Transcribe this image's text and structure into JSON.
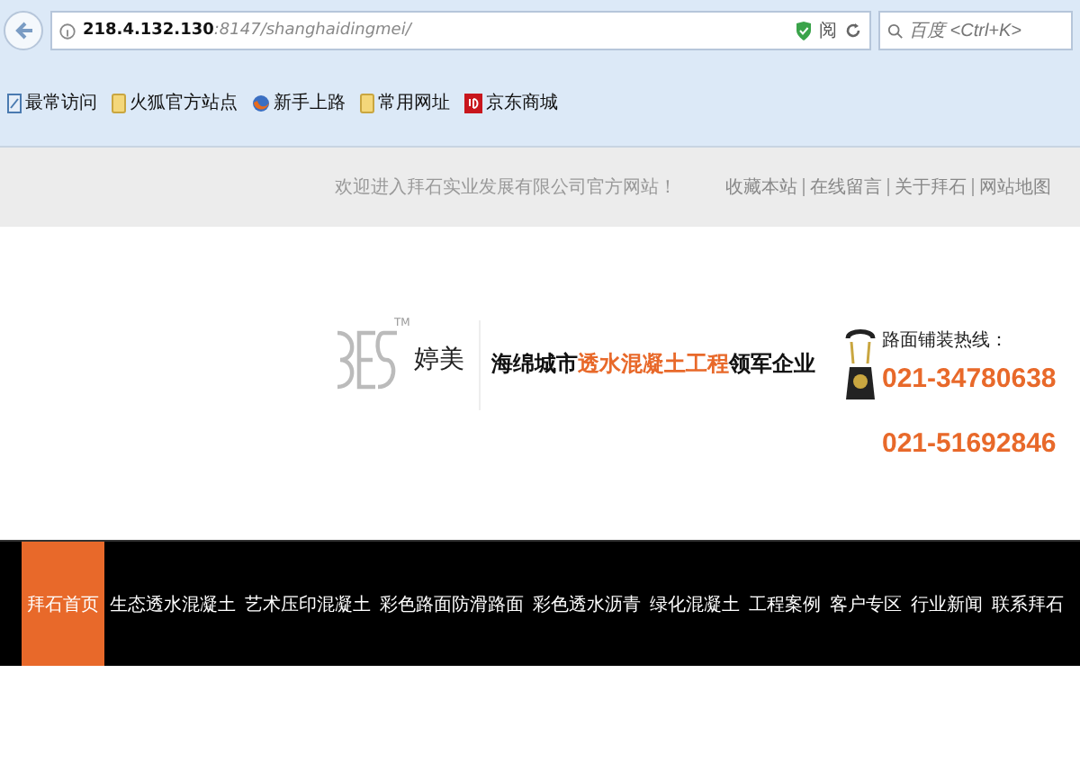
{
  "browser": {
    "url_host": "218.4.132.130",
    "url_path": ":8147/shanghaidingmei/",
    "reader_label": "阅",
    "search_placeholder": "百度 <Ctrl+K>",
    "bookmarks": [
      {
        "label": "最常访问",
        "kind": "page"
      },
      {
        "label": "火狐官方站点",
        "kind": "folder"
      },
      {
        "label": "新手上路",
        "kind": "firefox"
      },
      {
        "label": "常用网址",
        "kind": "folder"
      },
      {
        "label": "京东商城",
        "kind": "jd"
      }
    ]
  },
  "top_bar": {
    "welcome": "欢迎进入拜石实业发展有限公司官方网站！",
    "links": [
      "收藏本站",
      "在线留言",
      "关于拜石",
      "网站地图"
    ]
  },
  "header": {
    "logo_mark": "TM",
    "logo_text": "婷美",
    "slogan": [
      {
        "text": "海绵城市",
        "highlight": false
      },
      {
        "text": "透水混凝土工程",
        "highlight": true
      },
      {
        "text": "领军企业",
        "highlight": false
      }
    ],
    "hotline_label": "路面铺装热线：",
    "phones": [
      "021-34780638",
      "021-51692846"
    ]
  },
  "nav": [
    {
      "label": "拜石首页",
      "selected": true
    },
    {
      "label": "生态透水混凝土",
      "selected": false
    },
    {
      "label": "艺术压印混凝土",
      "selected": false
    },
    {
      "label": "彩色路面防滑路面",
      "selected": false
    },
    {
      "label": "彩色透水沥青",
      "selected": false
    },
    {
      "label": "绿化混凝土",
      "selected": false
    },
    {
      "label": "工程案例",
      "selected": false
    },
    {
      "label": "客户专区",
      "selected": false
    },
    {
      "label": "行业新闻",
      "selected": false
    },
    {
      "label": "联系拜石",
      "selected": false
    }
  ]
}
